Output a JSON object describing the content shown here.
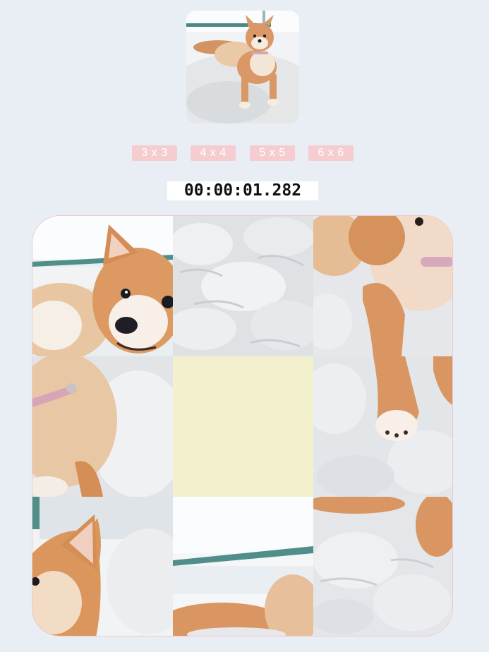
{
  "preview": {
    "image": "shiba-inu-puppy-on-white-rug"
  },
  "size_options": [
    {
      "label": "3 x 3"
    },
    {
      "label": "4 x 4"
    },
    {
      "label": "5 x 5"
    },
    {
      "label": "6 x 6"
    }
  ],
  "timer": {
    "value": "00:00:01.282"
  },
  "board": {
    "grid_size": 3,
    "tiles": [
      {
        "piece": 2,
        "label": "tile-puppy-face"
      },
      {
        "piece": 8,
        "label": "tile-white-fur"
      },
      {
        "piece": 6,
        "label": "tile-puppy-leg"
      },
      {
        "piece": 5,
        "label": "tile-puppy-collar"
      },
      {
        "piece": 0,
        "label": "empty-slot"
      },
      {
        "piece": 9,
        "label": "tile-rug-corner"
      },
      {
        "piece": 1,
        "label": "tile-puppy-ear"
      },
      {
        "piece": 4,
        "label": "tile-puppy-tail-window"
      },
      {
        "piece": 7,
        "label": "tile-rug-paw"
      }
    ]
  },
  "colors": {
    "background": "#e9eef4",
    "button": "#f5cdd0",
    "empty_tile": "#f3f1cd",
    "board_border": "#f0c8cc"
  }
}
